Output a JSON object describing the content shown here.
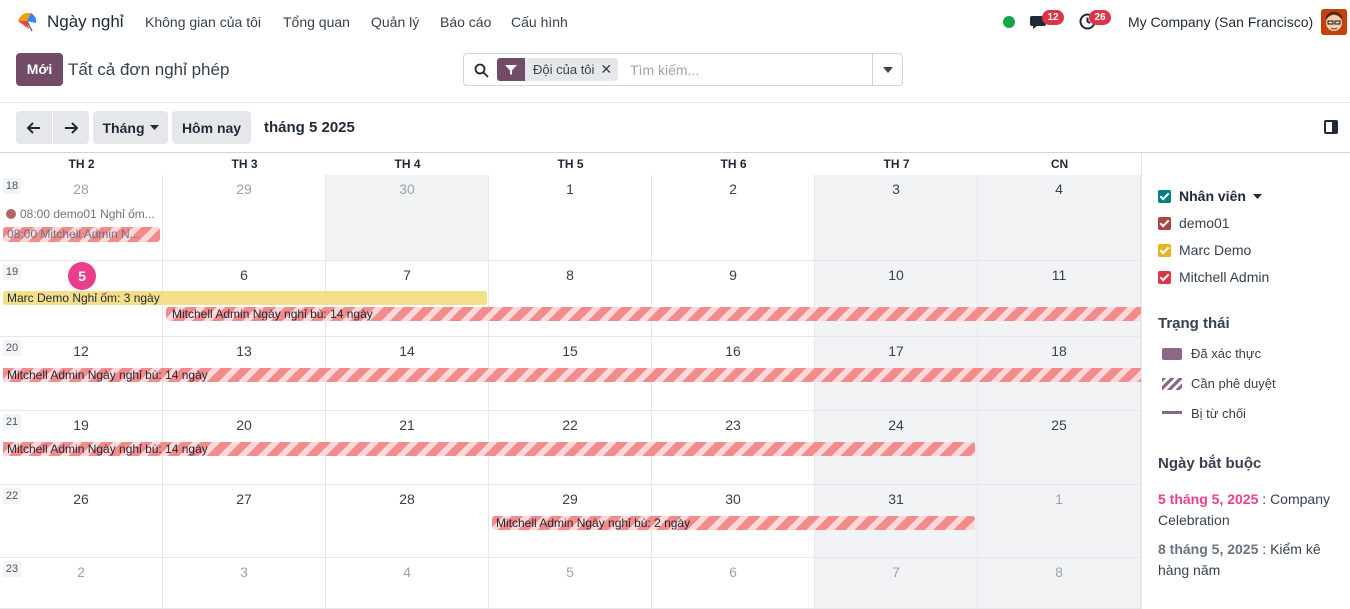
{
  "app": {
    "name": "Ngày nghỉ"
  },
  "menu": [
    "Không gian của tôi",
    "Tổng quan",
    "Quản lý",
    "Báo cáo",
    "Cấu hình"
  ],
  "systray": {
    "messages_count": "12",
    "activities_count": "26",
    "company": "My Company (San Francisco)"
  },
  "control": {
    "new_label": "Mới",
    "title": "Tất cả đơn nghỉ phép",
    "facet": "Đội của tôi",
    "search_placeholder": "Tìm kiếm..."
  },
  "toolbar": {
    "scale": "Tháng",
    "today": "Hôm nay",
    "period": "tháng 5 2025"
  },
  "calendar": {
    "weekdays": [
      "TH 2",
      "TH 3",
      "TH 4",
      "TH 5",
      "TH 6",
      "TH 7",
      "CN"
    ],
    "weeks": [
      {
        "num": "18",
        "days": [
          "28",
          "29",
          "30",
          "1",
          "2",
          "3",
          "4"
        ]
      },
      {
        "num": "19",
        "days": [
          "5",
          "6",
          "7",
          "8",
          "9",
          "10",
          "11"
        ]
      },
      {
        "num": "20",
        "days": [
          "12",
          "13",
          "14",
          "15",
          "16",
          "17",
          "18"
        ]
      },
      {
        "num": "21",
        "days": [
          "19",
          "20",
          "21",
          "22",
          "23",
          "24",
          "25"
        ]
      },
      {
        "num": "22",
        "days": [
          "26",
          "27",
          "28",
          "29",
          "30",
          "31",
          "1"
        ]
      },
      {
        "num": "23",
        "days": [
          "2",
          "3",
          "4",
          "5",
          "6",
          "7",
          "8"
        ]
      }
    ],
    "events": {
      "e1": "08:00 demo01 Nghỉ ốm...",
      "e2": "08:00 Mitchell Admin N...",
      "e3": "Marc Demo Nghỉ ốm: 3 ngày",
      "e4": "Mitchell Admin Ngày nghỉ bù: 14 ngày",
      "e5": "Mitchell Admin Ngày nghỉ bù: 14 ngày",
      "e6": "Mitchell Admin Ngày nghỉ bù: 14 ngày",
      "e7": "Mitchell Admin Ngày nghỉ bù: 2 ngày"
    }
  },
  "sidebar": {
    "employees_title": "Nhân viên",
    "employees": [
      {
        "name": "demo01",
        "color": "#a94442"
      },
      {
        "name": "Marc Demo",
        "color": "#e6b422"
      },
      {
        "name": "Mitchell Admin",
        "color": "#dc3545"
      }
    ],
    "status_title": "Trạng thái",
    "status": [
      "Đã xác thực",
      "Cần phê duyệt",
      "Bị từ chối"
    ],
    "mandatory_title": "Ngày bắt buộc",
    "mandatory": [
      {
        "date": "5 tháng 5, 2025",
        "sep": " : ",
        "name": "Company Celebration"
      },
      {
        "date": "8 tháng 5, 2025",
        "sep": " : ",
        "name": "Kiểm kê hàng năm"
      }
    ]
  }
}
